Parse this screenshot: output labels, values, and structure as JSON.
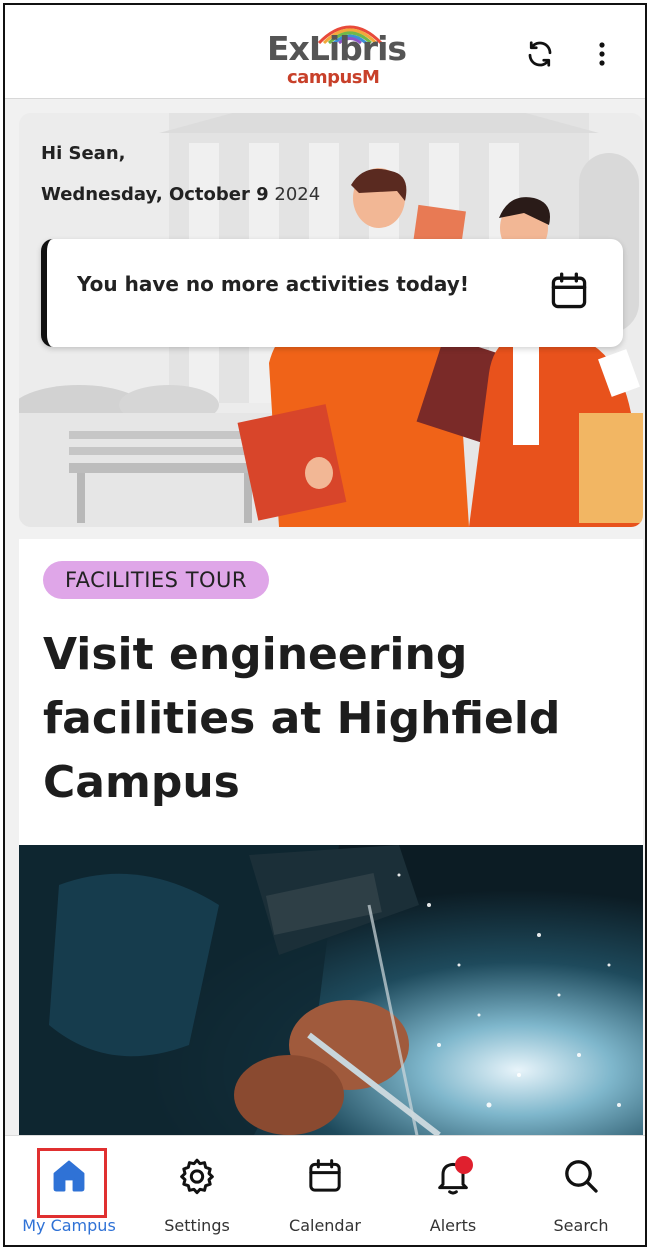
{
  "header": {
    "logo_main": "ExLibris",
    "logo_sub": "campusM",
    "refresh_icon": "refresh-icon",
    "more_icon": "more-vertical-icon"
  },
  "greeting": {
    "name_line": "Hi Sean,",
    "weekday_date": "Wednesday, October 9",
    "year": "2024"
  },
  "activity": {
    "message": "You have no more activities today!",
    "icon": "calendar-icon"
  },
  "feature": {
    "tag": "FACILITIES TOUR",
    "title": "Visit engineering facilities at Highfield Campus",
    "tag_color": "#dfa6e8"
  },
  "nav": {
    "items": [
      {
        "label": "My Campus",
        "icon": "home-icon",
        "active": true
      },
      {
        "label": "Settings",
        "icon": "gear-icon",
        "active": false
      },
      {
        "label": "Calendar",
        "icon": "calendar-icon",
        "active": false
      },
      {
        "label": "Alerts",
        "icon": "bell-icon",
        "active": false
      },
      {
        "label": "Search",
        "icon": "search-icon",
        "active": false
      }
    ]
  },
  "colors": {
    "accent": "#2f72d6",
    "brand_red": "#c8402a",
    "alert_badge": "#e0202e",
    "highlight_box": "#e03030"
  }
}
